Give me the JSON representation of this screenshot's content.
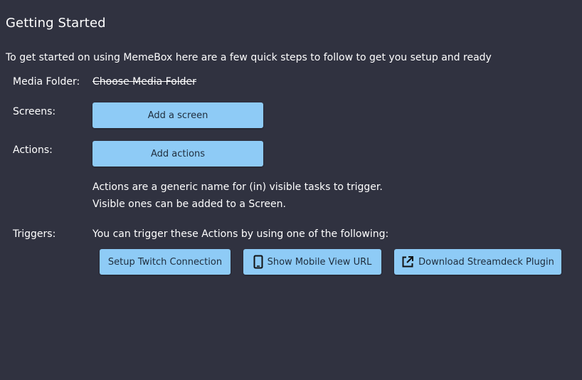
{
  "page": {
    "title": "Getting Started",
    "intro": "To get started on using MemeBox here are a few quick steps to follow to get you setup and ready"
  },
  "media_folder": {
    "label": "Media Folder:",
    "value": "Choose Media Folder"
  },
  "screens": {
    "label": "Screens:",
    "button_label": "Add a screen"
  },
  "actions": {
    "label": "Actions:",
    "button_label": "Add actions",
    "help_line_1": "Actions are a generic name for (in) visible tasks to trigger.",
    "help_line_2": "Visible ones can be added to a Screen."
  },
  "triggers": {
    "label": "Triggers:",
    "description": "You can trigger these Actions by using one of the following:",
    "buttons": [
      {
        "label": "Setup Twitch Connection",
        "icon": ""
      },
      {
        "label": "Show Mobile View URL",
        "icon": "mobile-phone-icon"
      },
      {
        "label": "Download Streamdeck Plugin",
        "icon": "open-in-new-icon"
      }
    ]
  },
  "colors": {
    "background": "#303240",
    "button": "#8ecbf6",
    "button_text": "#1f2d3d",
    "text": "#ffffff"
  }
}
